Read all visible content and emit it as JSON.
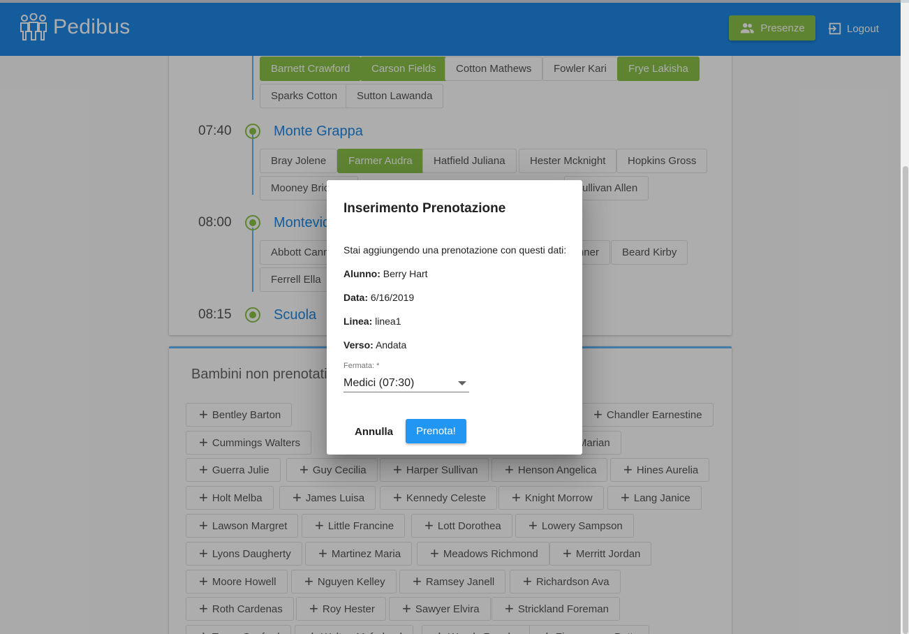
{
  "app": {
    "name": "Pedibus"
  },
  "header": {
    "presenze_label": "Presenze",
    "logout_label": "Logout"
  },
  "stops": [
    {
      "time": "07:40",
      "name": "Monte Grappa"
    },
    {
      "time": "08:00",
      "name": "Montevideo"
    },
    {
      "time": "08:15",
      "name": "Scuola"
    }
  ],
  "children_prev_stop": [
    {
      "name": "Barnett Crawford",
      "booked": true
    },
    {
      "name": "Carson Fields",
      "booked": true
    },
    {
      "name": "Cotton Mathews",
      "booked": false
    },
    {
      "name": "Fowler Kari",
      "booked": false
    },
    {
      "name": "Frye Lakisha",
      "booked": true
    },
    {
      "name": "Sparks Cotton",
      "booked": false
    },
    {
      "name": "Sutton Lawanda",
      "booked": false
    }
  ],
  "children_monte_grappa": [
    {
      "name": "Bray Jolene",
      "booked": false
    },
    {
      "name": "Farmer Audra",
      "booked": true
    },
    {
      "name": "Hatfield Juliana",
      "booked": false
    },
    {
      "name": "Hester Mcknight",
      "booked": false
    },
    {
      "name": "Hopkins Gross",
      "booked": false
    },
    {
      "name": "Mooney Bridgett",
      "booked": false
    },
    {
      "name": "Sullivan Allen",
      "booked": false
    }
  ],
  "children_montevideo": [
    {
      "name": "Abbott Cannon",
      "booked": false
    },
    {
      "name": "Barker Tanner",
      "booked": false
    },
    {
      "name": "Beard Kirby",
      "booked": false
    },
    {
      "name": "Ferrell Ella",
      "booked": false
    }
  ],
  "unbooked": {
    "title": "Bambini non prenotati",
    "children": [
      "Bentley Barton",
      "Chandler Earnestine",
      "Cummings Walters",
      "Marian",
      "Guerra Julie",
      "Guy Cecilia",
      "Harper Sullivan",
      "Henson Angelica",
      "Hines Aurelia",
      "Holt Melba",
      "James Luisa",
      "Kennedy Celeste",
      "Knight Morrow",
      "Lang Janice",
      "Lawson Margret",
      "Little Francine",
      "Lott Dorothea",
      "Lowery Sampson",
      "Lyons Daugherty",
      "Martinez Maria",
      "Meadows Richmond",
      "Merritt Jordan",
      "Moore Howell",
      "Nguyen Kelley",
      "Ramsey Janell",
      "Richardson Ava",
      "Roth Cardenas",
      "Roy Hester",
      "Sawyer Elvira",
      "Strickland Foreman",
      "Tyson Sanford",
      "Walton Mcfarland",
      "Woods Rosales",
      "Zimmerman Potts"
    ]
  },
  "dialog": {
    "title": "Inserimento Prenotazione",
    "intro": "Stai aggiungendo una prenotazione con questi dati:",
    "alunno_label": "Alunno:",
    "alunno_value": "Berry Hart",
    "data_label": "Data:",
    "data_value": "6/16/2019",
    "linea_label": "Linea:",
    "linea_value": "linea1",
    "verso_label": "Verso:",
    "verso_value": "Andata",
    "fermata_label": "Fermata: *",
    "fermata_value": "Medici (07:30)",
    "cancel_label": "Annulla",
    "confirm_label": "Prenota!"
  },
  "colors": {
    "primary": "#1e88e5",
    "accent": "#8bc34a",
    "confirm": "#2196f3"
  }
}
